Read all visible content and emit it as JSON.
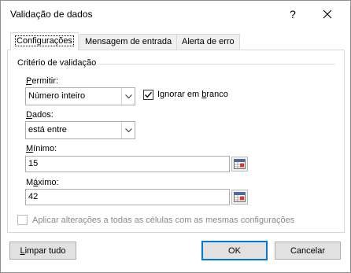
{
  "window": {
    "title": "Validação de dados",
    "help_glyph": "?",
    "close_icon": "close-icon"
  },
  "tabs": [
    {
      "label": "Configurações",
      "active": true
    },
    {
      "label": "Mensagem de entrada",
      "active": false
    },
    {
      "label": "Alerta de erro",
      "active": false
    }
  ],
  "criteria": {
    "group_title": "Critério de validação",
    "allow": {
      "label_accel": "P",
      "label_rest": "ermitir:",
      "value": "Número inteiro"
    },
    "ignore_blank": {
      "label_pre": "Ignorar em ",
      "label_accel": "b",
      "label_post": "ranco",
      "checked": true
    },
    "data": {
      "label_accel": "D",
      "label_rest": "ados:",
      "value": "está entre"
    },
    "minimum": {
      "label_accel": "M",
      "label_rest": "ínimo:",
      "value": "15"
    },
    "maximum": {
      "label_pre": "M",
      "label_accel": "á",
      "label_post": "ximo:",
      "value": "42"
    }
  },
  "apply_all": {
    "label": "Aplicar alterações a todas as células com as mesmas configurações",
    "checked": false,
    "enabled": false
  },
  "buttons": {
    "clear_accel": "L",
    "clear_rest": "impar tudo",
    "ok": "OK",
    "cancel": "Cancelar"
  },
  "colors": {
    "default_button_border": "#0078d7",
    "disabled_text": "#8a8a8a"
  }
}
